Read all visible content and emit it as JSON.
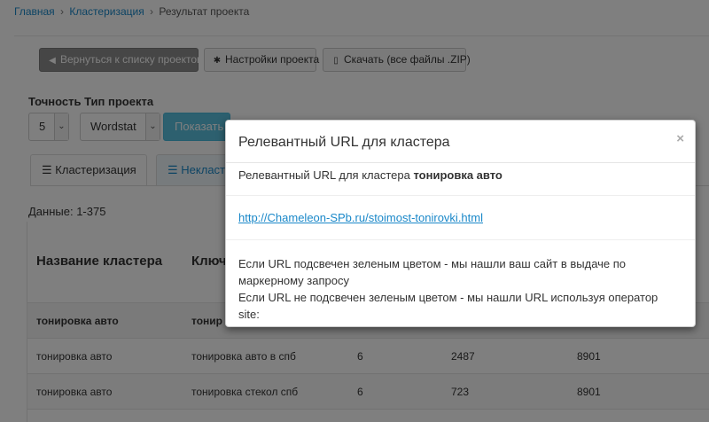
{
  "breadcrumb": {
    "home": "Главная",
    "sep1": "›",
    "clustering": "Кластеризация",
    "sep2": "›",
    "current": "Результат проекта"
  },
  "toolbar": {
    "back_label": "Вернуться к списку проектов",
    "settings_label": "Настройки проекта",
    "download_label": "Скачать (все файлы .ZIP)"
  },
  "filters": {
    "label": "Точность Тип проекта",
    "accuracy_value": "5",
    "type_value": "Wordstat",
    "show_label": "Показать"
  },
  "tabs": [
    {
      "label": "Кластеризация"
    },
    {
      "label": "Некласт"
    }
  ],
  "data_count": "Данные: 1-375",
  "table": {
    "headers": [
      "Название кластера",
      "Ключ"
    ],
    "group_row": [
      "тонировка авто",
      "тонир"
    ],
    "rows": [
      [
        "тонировка авто",
        "тонировка авто в спб",
        "6",
        "2487",
        "8901"
      ],
      [
        "тонировка авто",
        "тонировка стекол спб",
        "6",
        "723",
        "8901"
      ]
    ]
  },
  "modal": {
    "title": "Релевантный URL для кластера",
    "close": "×",
    "line1_prefix": "Релевантный URL для кластера",
    "line1_bold": "тонировка авто",
    "link": "http://Chameleon-SPb.ru/stoimost-tonirovki.html",
    "note1": "Если URL подсвечен зеленым цветом - мы нашли ваш сайт в выдаче по маркерному запросу",
    "note2": "Если URL не подсвечен зеленым цветом - мы нашли URL используя оператор site:"
  },
  "colors": {
    "accent": "#1a88c9",
    "show_button": "#5bc0de",
    "back_button": "#8d8d8d",
    "overlay": "rgba(0,0,0,0.5)"
  },
  "icons": {
    "back": "arrow-left-icon",
    "settings": "gear-icon",
    "download": "file-download-icon",
    "tab_clustering": "list-icon",
    "tab_unclustered": "list-icon",
    "close": "close-icon"
  }
}
